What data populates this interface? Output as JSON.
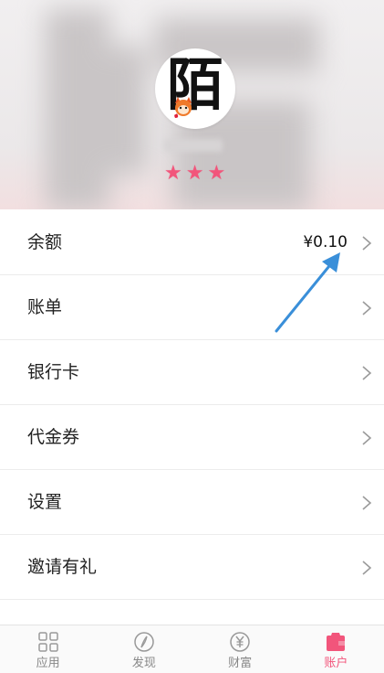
{
  "profile": {
    "avatar_char": "陌",
    "star_count": 3
  },
  "menu": {
    "items": [
      {
        "label": "余额",
        "value": "¥0.10"
      },
      {
        "label": "账单"
      },
      {
        "label": "银行卡"
      },
      {
        "label": "代金券"
      },
      {
        "label": "设置"
      },
      {
        "label": "邀请有礼"
      }
    ]
  },
  "tabbar": {
    "active_color": "#f2557b",
    "tabs": [
      {
        "label": "应用",
        "icon": "grid-icon"
      },
      {
        "label": "发现",
        "icon": "compass-icon"
      },
      {
        "label": "财富",
        "icon": "yen-icon"
      },
      {
        "label": "账户",
        "icon": "wallet-icon",
        "active": true
      }
    ]
  }
}
